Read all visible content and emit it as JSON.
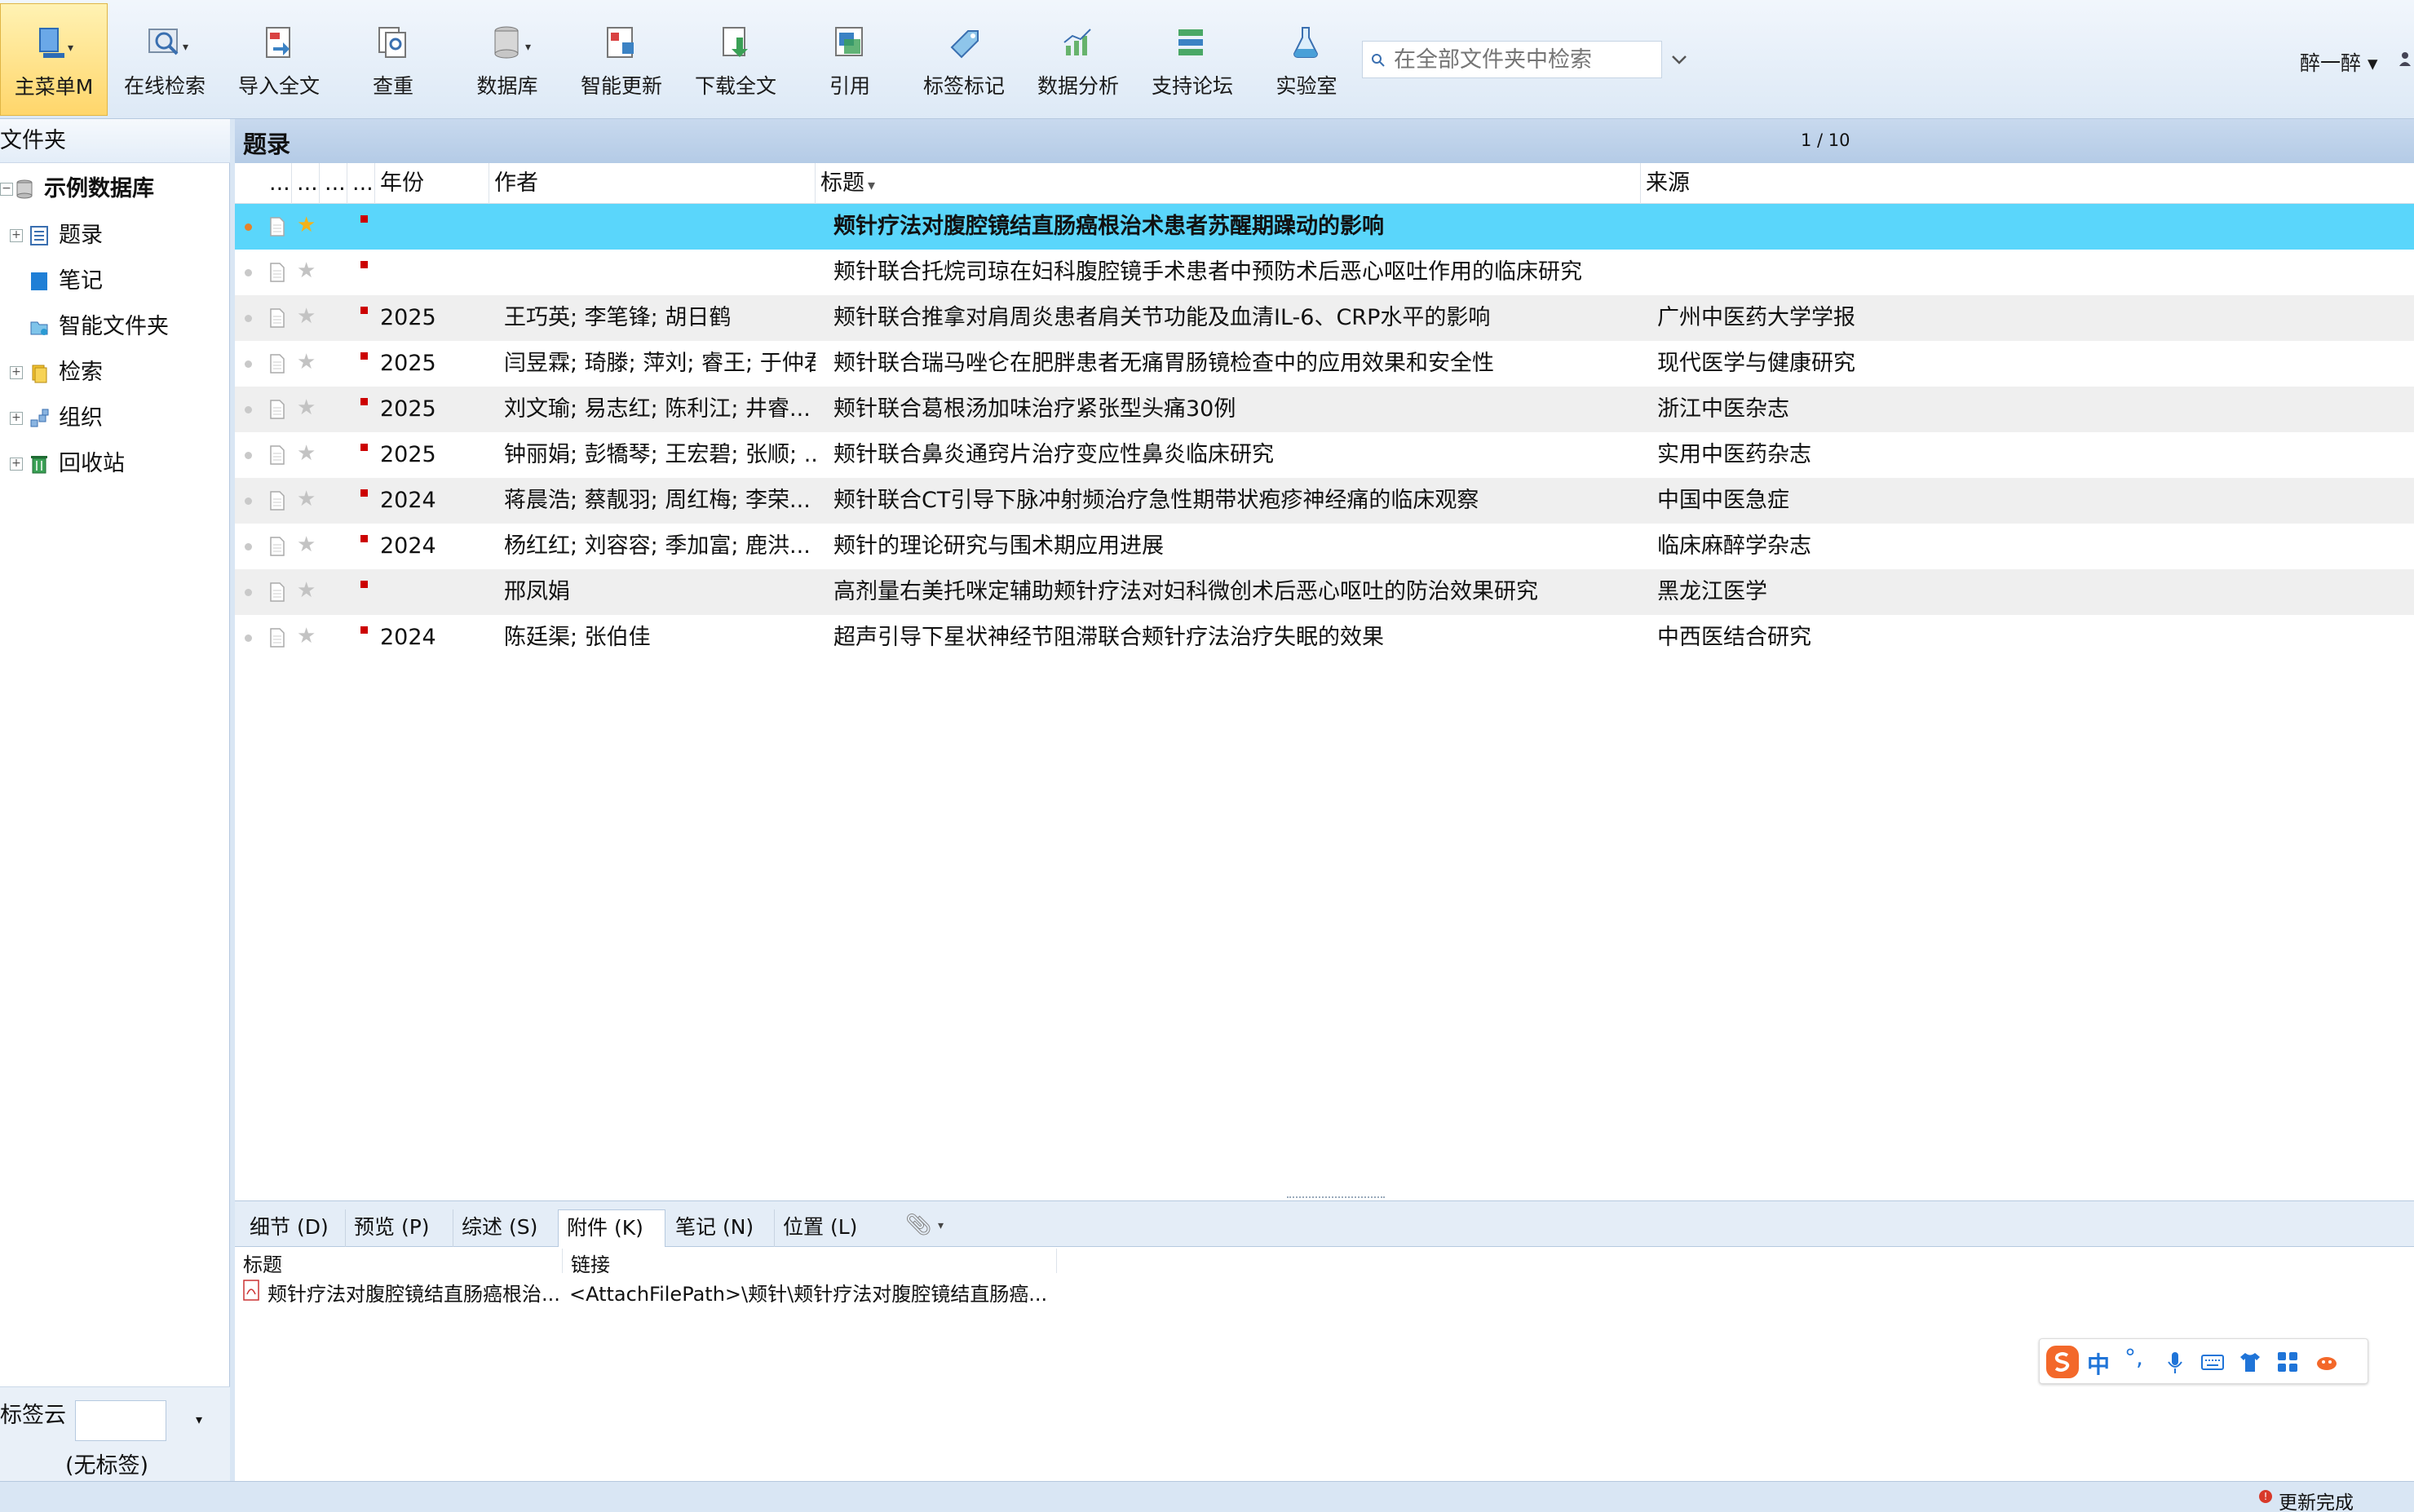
{
  "toolbar": {
    "items": [
      {
        "label": "主菜单M",
        "icon": "main-menu-icon"
      },
      {
        "label": "在线检索",
        "icon": "online-search-icon"
      },
      {
        "label": "导入全文",
        "icon": "import-fulltext-icon"
      },
      {
        "label": "查重",
        "icon": "dedupe-icon"
      },
      {
        "label": "数据库",
        "icon": "database-icon"
      },
      {
        "label": "智能更新",
        "icon": "smart-update-icon"
      },
      {
        "label": "下载全文",
        "icon": "download-fulltext-icon"
      },
      {
        "label": "引用",
        "icon": "cite-icon"
      },
      {
        "label": "标签标记",
        "icon": "tag-icon"
      },
      {
        "label": "数据分析",
        "icon": "analysis-icon"
      },
      {
        "label": "支持论坛",
        "icon": "forum-icon"
      },
      {
        "label": "实验室",
        "icon": "lab-icon"
      }
    ],
    "search_placeholder": "在全部文件夹中检索",
    "user_label": "醉一醉 ▾"
  },
  "sidebar": {
    "header": "文件夹",
    "root": "示例数据库",
    "items": [
      {
        "label": "题录",
        "icon": "records-icon"
      },
      {
        "label": "笔记",
        "icon": "notes-icon"
      },
      {
        "label": "智能文件夹",
        "icon": "smart-folder-icon"
      },
      {
        "label": "检索",
        "icon": "search-folder-icon"
      },
      {
        "label": "组织",
        "icon": "organize-icon"
      },
      {
        "label": "回收站",
        "icon": "recycle-bin-icon"
      }
    ],
    "tagcloud_label": "标签云",
    "tagcloud_empty": "(无标签)"
  },
  "list": {
    "title": "题录",
    "pager": "1 / 10",
    "columns": {
      "c1": "...",
      "c2": "...",
      "c3": "...",
      "c4": "...",
      "year": "年份",
      "author": "作者",
      "title": "标题",
      "source": "来源"
    },
    "rows": [
      {
        "year": "",
        "author": "",
        "title": "颊针疗法对腹腔镜结直肠癌根治术患者苏醒期躁动的影响",
        "source": ""
      },
      {
        "year": "",
        "author": "",
        "title": "颊针联合托烷司琼在妇科腹腔镜手术患者中预防术后恶心呕吐作用的临床研究",
        "source": ""
      },
      {
        "year": "2025",
        "author": "王巧英; 李笔锋; 胡日鹤",
        "title": "颊针联合推拿对肩周炎患者肩关节功能及血清IL-6、CRP水平的影响",
        "source": "广州中医药大学学报"
      },
      {
        "year": "2025",
        "author": "闫昱霖; 琦滕; 萍刘; 睿王; 于仲君",
        "title": "颊针联合瑞马唑仑在肥胖患者无痛胃肠镜检查中的应用效果和安全性",
        "source": "现代医学与健康研究"
      },
      {
        "year": "2025",
        "author": "刘文瑜; 易志红; 陈利江; 井睿...",
        "title": "颊针联合葛根汤加味治疗紧张型头痛30例",
        "source": "浙江中医杂志"
      },
      {
        "year": "2025",
        "author": "钟丽娟; 彭犞琴; 王宏碧; 张顺; ...",
        "title": "颊针联合鼻炎通窍片治疗变应性鼻炎临床研究",
        "source": "实用中医药杂志"
      },
      {
        "year": "2024",
        "author": "蒋晨浩; 蔡靓羽; 周红梅; 李荣...",
        "title": "颊针联合CT引导下脉冲射频治疗急性期带状疱疹神经痛的临床观察",
        "source": "中国中医急症"
      },
      {
        "year": "2024",
        "author": "杨红红; 刘容容; 季加富; 鹿洪...",
        "title": "颊针的理论研究与围术期应用进展",
        "source": "临床麻醉学杂志"
      },
      {
        "year": "",
        "author": "邢凤娟",
        "title": "高剂量右美托咪定辅助颊针疗法对妇科微创术后恶心呕吐的防治效果研究",
        "source": "黑龙江医学"
      },
      {
        "year": "2024",
        "author": "陈廷渠; 张伯佳",
        "title": "超声引导下星状神经节阻滞联合颊针疗法治疗失眠的效果",
        "source": "中西医结合研究"
      }
    ]
  },
  "detail": {
    "tabs": [
      "细节 (D)",
      "预览 (P)",
      "综述 (S)",
      "附件 (K)",
      "笔记 (N)",
      "位置 (L)"
    ],
    "active_tab": "附件 (K)",
    "attachment_headers": {
      "title": "标题",
      "link": "链接"
    },
    "attachment": {
      "title": "颊针疗法对腹腔镜结直肠癌根治...",
      "link": "<AttachFilePath>\\颊针\\颊针疗法对腹腔镜结直肠癌..."
    }
  },
  "status": {
    "text": "更新完成"
  },
  "ime": {
    "label": "中"
  },
  "colors": {
    "selected_row": "#5ad6fb",
    "toolbar_active": "#ffd66b",
    "header_band": "#c0d4ec",
    "flag": "#cc0000"
  }
}
